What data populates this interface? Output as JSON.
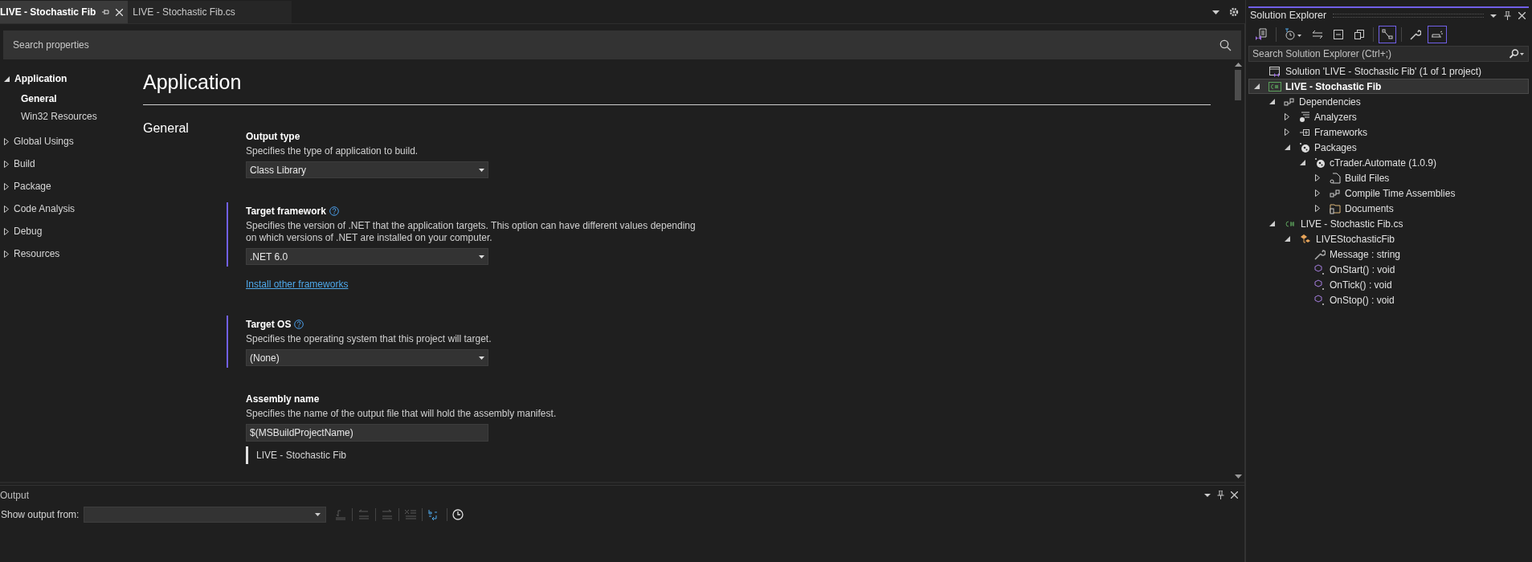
{
  "tabs": [
    {
      "label": "LIVE - Stochastic Fib",
      "selected": true,
      "pinned": true
    },
    {
      "label": "LIVE - Stochastic Fib.cs",
      "selected": false,
      "pinned": false
    }
  ],
  "search": {
    "placeholder": "Search properties"
  },
  "nav": [
    {
      "label": "Application",
      "expanded": true,
      "children": [
        {
          "label": "General",
          "selected": true
        },
        {
          "label": "Win32 Resources",
          "selected": false
        }
      ]
    },
    {
      "label": "Global Usings",
      "expanded": false
    },
    {
      "label": "Build",
      "expanded": false
    },
    {
      "label": "Package",
      "expanded": false
    },
    {
      "label": "Code Analysis",
      "expanded": false
    },
    {
      "label": "Debug",
      "expanded": false
    },
    {
      "label": "Resources",
      "expanded": false
    }
  ],
  "page": {
    "title": "Application",
    "section": "General",
    "fields": [
      {
        "kind": "dropdown",
        "label": "Output type",
        "help": false,
        "modified": false,
        "description": "Specifies the type of application to build.",
        "value": "Class Library"
      },
      {
        "kind": "dropdown",
        "label": "Target framework",
        "help": true,
        "modified": true,
        "description": "Specifies the version of .NET that the application targets. This option can have different values depending on which versions of .NET are installed on your computer.",
        "value": ".NET 6.0",
        "link": "Install other frameworks"
      },
      {
        "kind": "dropdown",
        "label": "Target OS",
        "help": true,
        "modified": true,
        "description": "Specifies the operating system that this project will target.",
        "value": "(None)"
      },
      {
        "kind": "text",
        "label": "Assembly name",
        "help": false,
        "modified": false,
        "description": "Specifies the name of the output file that will hold the assembly manifest.",
        "value": "$(MSBuildProjectName)",
        "preview": "LIVE - Stochastic Fib"
      }
    ]
  },
  "output": {
    "title": "Output",
    "show_label": "Show output from:",
    "tools": [
      {
        "kind": "goto",
        "disabled": true
      },
      {
        "kind": "prev",
        "disabled": true
      },
      {
        "kind": "next",
        "disabled": true
      },
      {
        "kind": "clear",
        "disabled": true
      },
      {
        "kind": "wrap",
        "disabled": false
      },
      {
        "kind": "clock",
        "disabled": false
      }
    ]
  },
  "solution_explorer": {
    "title": "Solution Explorer",
    "toolbar": [
      {
        "kind": "vsdoc",
        "selected": false
      },
      {
        "kind": "history",
        "selected": false
      },
      {
        "kind": "sync",
        "selected": false
      },
      {
        "kind": "collapse",
        "selected": false
      },
      {
        "kind": "copies",
        "selected": false
      },
      {
        "kind": "tree",
        "selected": true
      },
      {
        "kind": "wrench",
        "selected": false
      },
      {
        "kind": "preview",
        "selected": true
      }
    ],
    "search": {
      "placeholder": "Search Solution Explorer (Ctrl+;)"
    },
    "tree": [
      {
        "label": "Solution 'LIVE - Stochastic Fib' (1 of 1 project)",
        "kind": "solution",
        "selected": false
      },
      {
        "label": "LIVE - Stochastic Fib",
        "kind": "csproj",
        "expanded": true,
        "selected": true,
        "children": [
          {
            "label": "Dependencies",
            "kind": "deps",
            "expanded": true,
            "selected": false,
            "children": [
              {
                "label": "Analyzers",
                "kind": "analyzers",
                "expanded": false,
                "selected": false
              },
              {
                "label": "Frameworks",
                "kind": "frameworks",
                "expanded": false,
                "selected": false
              },
              {
                "label": "Packages",
                "kind": "package",
                "expanded": true,
                "selected": false,
                "children": [
                  {
                    "label": "cTrader.Automate (1.0.9)",
                    "kind": "package",
                    "expanded": true,
                    "selected": false,
                    "children": [
                      {
                        "label": "Build Files",
                        "kind": "file",
                        "expanded": false,
                        "selected": false
                      },
                      {
                        "label": "Compile Time Assemblies",
                        "kind": "deps",
                        "expanded": false,
                        "selected": false
                      },
                      {
                        "label": "Documents",
                        "kind": "folder",
                        "expanded": false,
                        "selected": false
                      }
                    ]
                  }
                ]
              }
            ]
          },
          {
            "label": "LIVE - Stochastic Fib.cs",
            "kind": "csfile",
            "expanded": true,
            "selected": false,
            "children": [
              {
                "label": "LIVEStochasticFib",
                "kind": "class",
                "expanded": true,
                "selected": false,
                "children": [
                  {
                    "label": "Message : string",
                    "kind": "property",
                    "selected": false
                  },
                  {
                    "label": "OnStart() : void",
                    "kind": "method",
                    "selected": false
                  },
                  {
                    "label": "OnTick() : void",
                    "kind": "method",
                    "selected": false
                  },
                  {
                    "label": "OnStop() : void",
                    "kind": "method",
                    "selected": false
                  }
                ]
              }
            ]
          }
        ]
      }
    ]
  }
}
